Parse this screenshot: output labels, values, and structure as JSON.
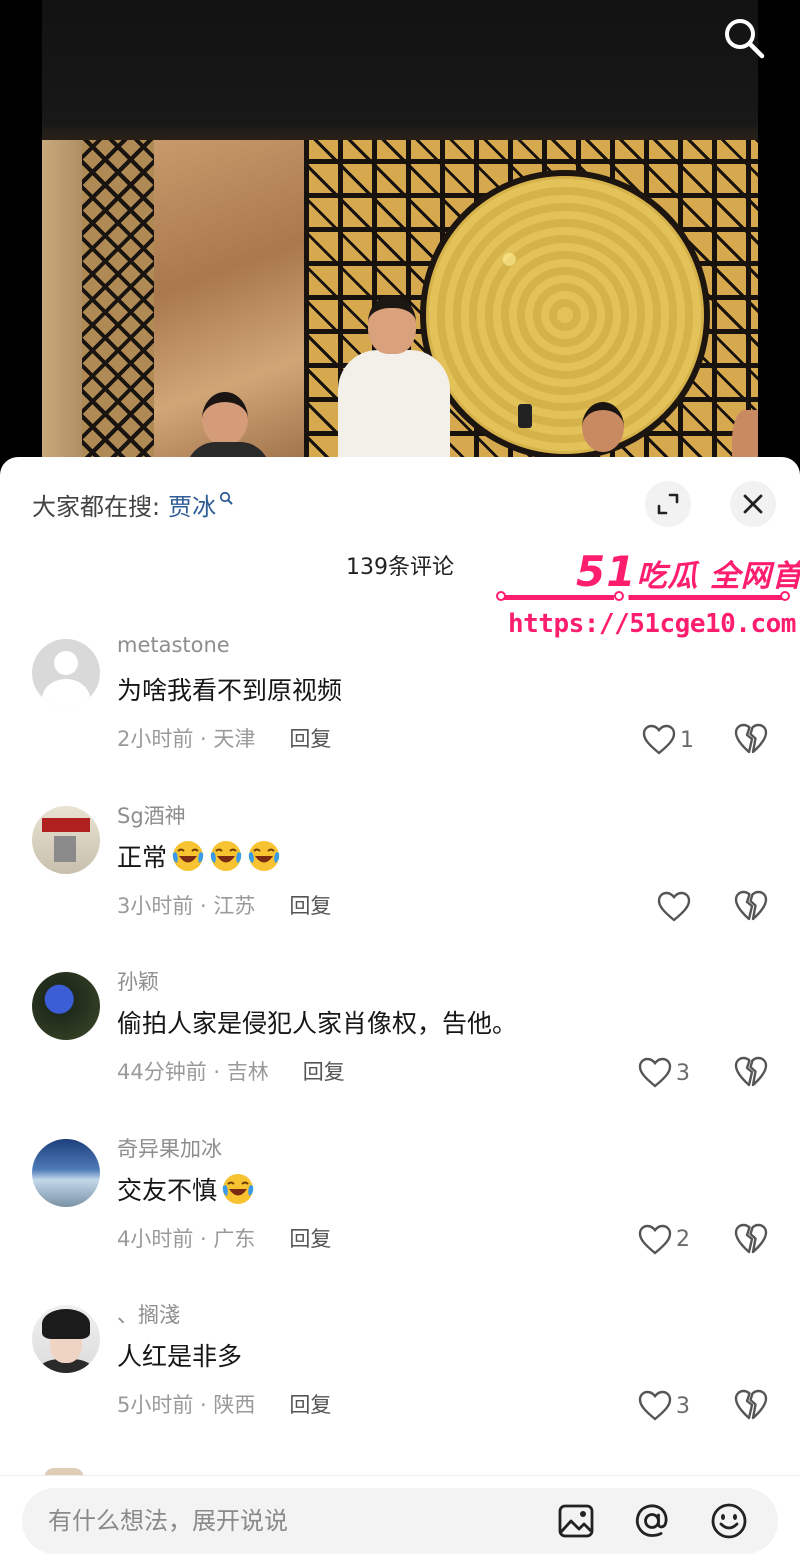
{
  "header": {
    "hot_search_label": "大家都在搜:",
    "hot_search_term": "贾冰"
  },
  "comments_header": {
    "count_label": "139条评论"
  },
  "watermark": {
    "brand_number": "51",
    "brand_text": "吃瓜 全网首发",
    "url": "https://51cge10.com",
    "color": "#ff1e6e"
  },
  "comments": [
    {
      "username": "metastone",
      "text": "为啥我看不到原视频",
      "emojis": 0,
      "time_location": "2小时前 · 天津",
      "reply_label": "回复",
      "likes": "1"
    },
    {
      "username": "Sg酒神",
      "text": "正常",
      "emojis": 3,
      "time_location": "3小时前 · 江苏",
      "reply_label": "回复",
      "likes": ""
    },
    {
      "username": "孙颖",
      "text": "偷拍人家是侵犯人家肖像权，告他。",
      "emojis": 0,
      "time_location": "44分钟前 · 吉林",
      "reply_label": "回复",
      "likes": "3"
    },
    {
      "username": "奇异果加冰",
      "text": "交友不慎",
      "emojis": 1,
      "time_location": "4小时前 · 广东",
      "reply_label": "回复",
      "likes": "2"
    },
    {
      "username": "、搁淺",
      "text": "人红是非多",
      "emojis": 0,
      "time_location": "5小时前 · 陕西",
      "reply_label": "回复",
      "likes": "3"
    }
  ],
  "input_bar": {
    "placeholder": "有什么想法，展开说说",
    "value": ""
  },
  "icons": {
    "top_search": "search-icon",
    "expand": "expand-icon",
    "close": "close-icon",
    "like": "heart-icon",
    "dislike": "broken-heart-icon",
    "image": "image-icon",
    "mention": "at-icon",
    "emoji": "emoji-icon",
    "laugh_cry_emoji": "laugh-cry-emoji"
  },
  "colors": {
    "link_blue": "#2e5c97",
    "emoji_yellow": "#f7c331",
    "emoji_blue": "#3a9be8"
  }
}
